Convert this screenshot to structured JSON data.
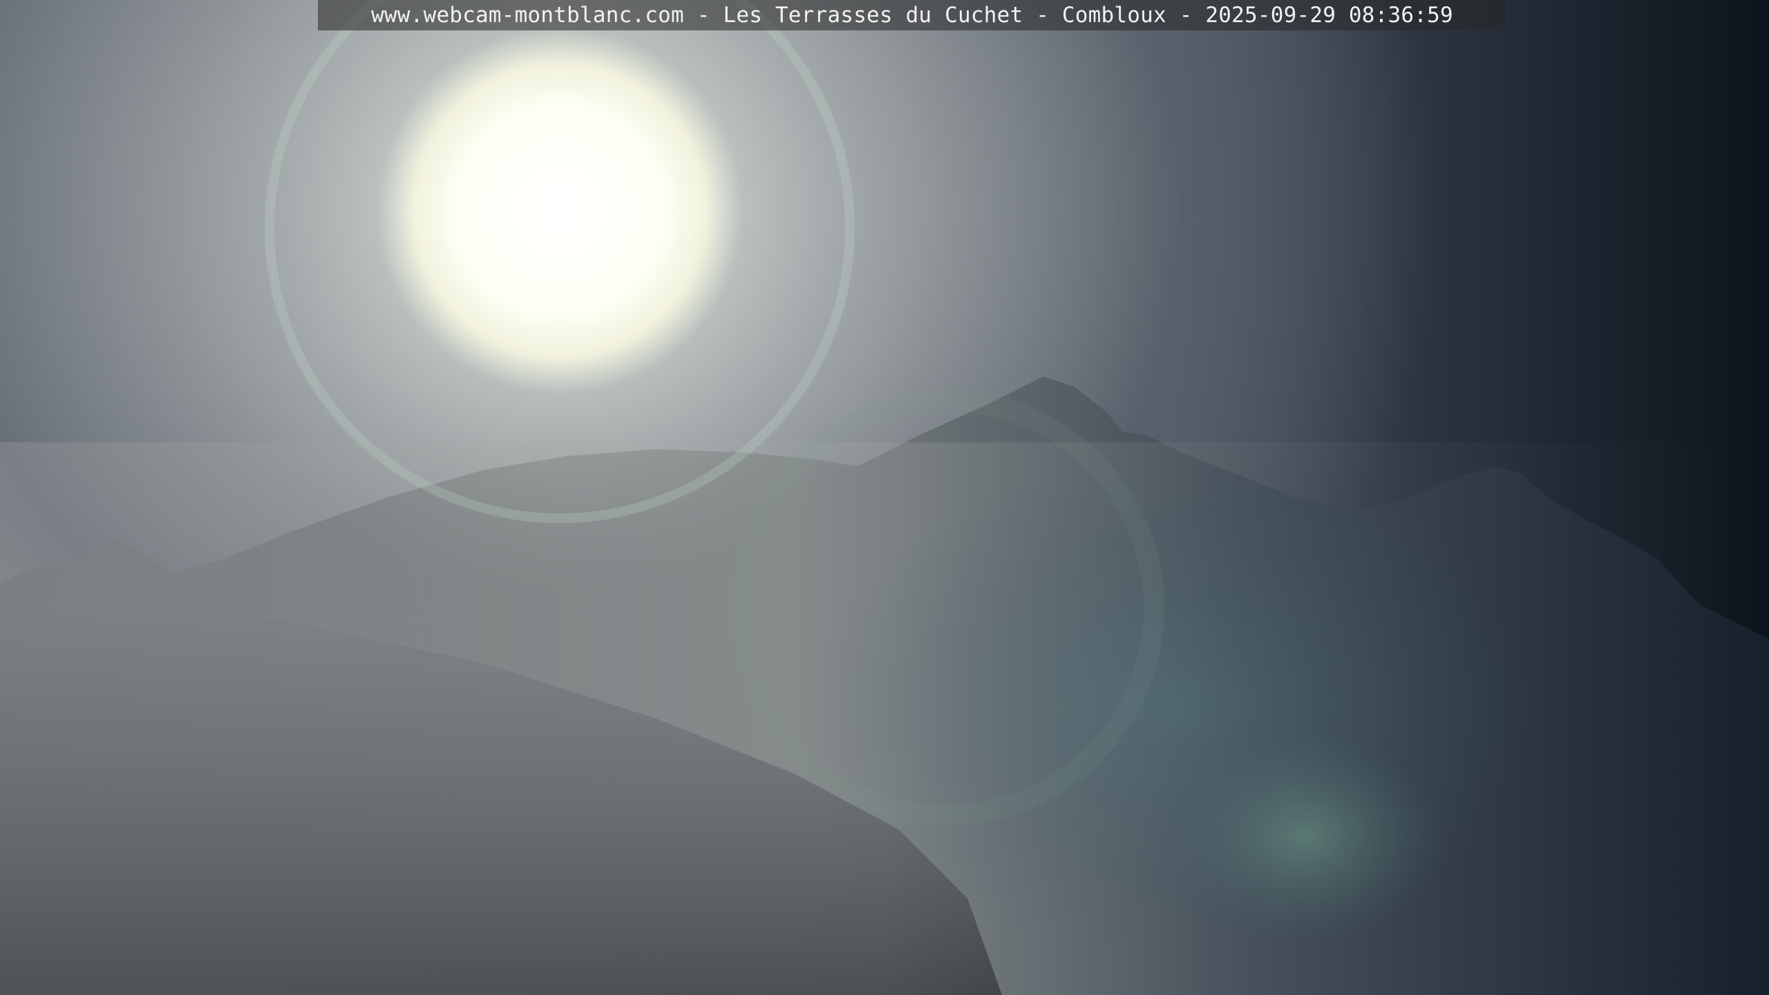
{
  "overlay": {
    "caption": "www.webcam-montblanc.com - Les Terrasses du Cuchet - Combloux - 2025-09-29 08:36:59"
  },
  "scene": {
    "subject": "sun over mountain ridge with lens flare",
    "colors": {
      "sky_left": "#8d9195",
      "sky_right": "#0c131b",
      "sun_core": "#ffffff",
      "mountain_far": "#5a6168",
      "mountain_near": "#26303a"
    }
  }
}
